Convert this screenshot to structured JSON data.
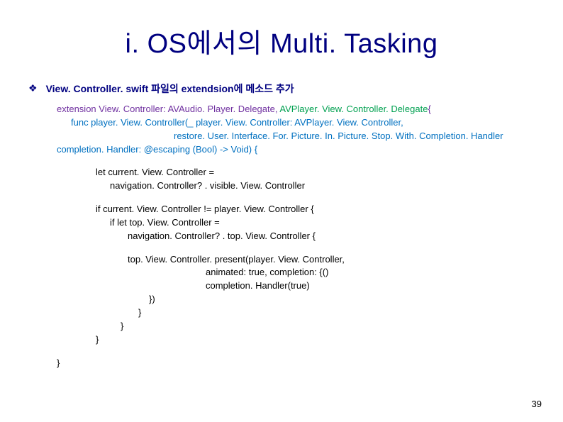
{
  "title": "i. OS에서의 Multi. Tasking",
  "subtitle": "View. Controller. swift 파일의 extendsion에 메소드 추가",
  "code": {
    "line1_a": "extension View. Controller: AVAudio. Player. Delegate, ",
    "line1_b": "AVPlayer. View. Controller. Delegate",
    "line1_c": "{",
    "line2": "func player. View. Controller(_ player. View. Controller: AVPlayer. View. Controller,",
    "line3": "restore. User. Interface. For. Picture. In. Picture. Stop. With. Completion. Handler",
    "line4": "completion. Handler: @escaping (Bool) -> Void) {",
    "line5": "let current. View. Controller =",
    "line6": "navigation. Controller? . visible. View. Controller",
    "line7": "if current. View. Controller != player. View. Controller {",
    "line8": "if let top. View. Controller =",
    "line9": "navigation. Controller? . top. View. Controller {",
    "line10": "top. View. Controller. present(player. View. Controller,",
    "line11": "animated: true, completion: {()",
    "line12": "completion. Handler(true)",
    "line13": "})",
    "line14": "}",
    "line15": "}",
    "line16": "}",
    "line17": "}"
  },
  "bulletGlyph": "❖",
  "pageNumber": "39"
}
